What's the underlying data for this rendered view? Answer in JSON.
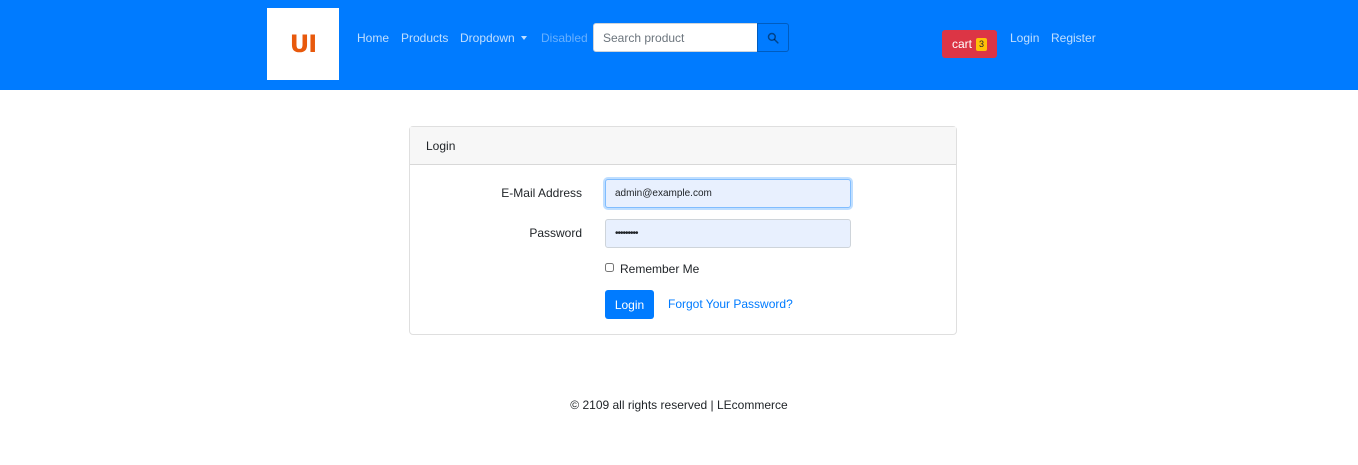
{
  "navbar": {
    "logo_text": "UI",
    "links": {
      "home": "Home",
      "products": "Products",
      "dropdown": "Dropdown",
      "disabled": "Disabled",
      "login": "Login",
      "register": "Register"
    },
    "search": {
      "placeholder": "Search product",
      "value": ""
    },
    "cart": {
      "label": "cart",
      "count": "3"
    },
    "background_color": "#007bff"
  },
  "login_card": {
    "header": "Login",
    "email": {
      "label": "E-Mail Address",
      "value": "admin@example.com"
    },
    "password": {
      "label": "Password",
      "value": "•••••••••"
    },
    "remember_label": "Remember Me",
    "remember_checked": false,
    "submit_label": "Login",
    "forgot_label": "Forgot Your Password?"
  },
  "footer": {
    "text": "© 2109 all rights reserved | LEcommerce"
  },
  "icons": {
    "search": "search-icon",
    "dropdown": "caret-down-icon"
  }
}
